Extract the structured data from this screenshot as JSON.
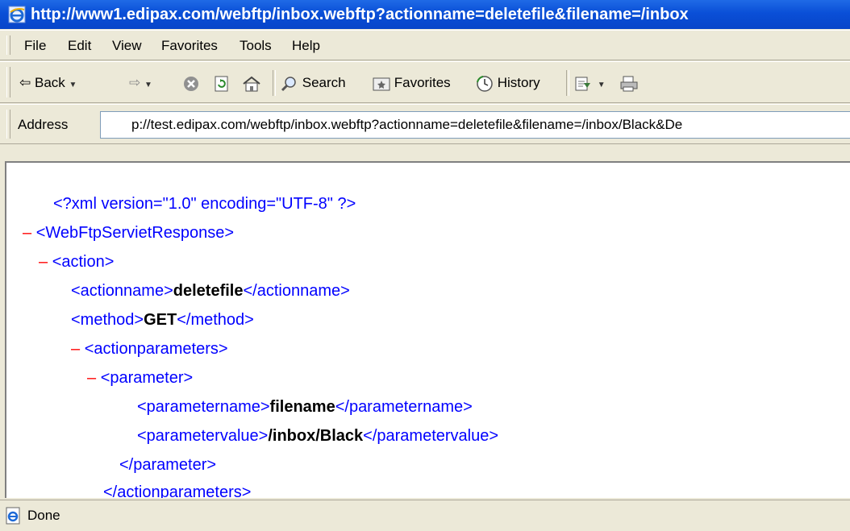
{
  "window": {
    "title": "http://www1.edipax.com/webftp/inbox.webftp?actionname=deletefile&filename=/inbox"
  },
  "menu": {
    "items": [
      "File",
      "Edit",
      "View",
      "Favorites",
      "Tools",
      "Help"
    ]
  },
  "toolbar": {
    "back_label": "Back",
    "search_label": "Search",
    "favorites_label": "Favorites",
    "history_label": "History"
  },
  "address": {
    "label": "Address",
    "value": "p://test.edipax.com/webftp/inbox.webftp?actionname=deletefile&filename=/inbox/Black&De"
  },
  "xml": {
    "decl": "<?xml version=\"1.0\" encoding=\"UTF-8\" ?>",
    "root_open": "<WebFtpServietResponse>",
    "action_open": "<action>",
    "actionname_open": "<actionname>",
    "actionname_value": "deletefile",
    "actionname_close": "</actionname>",
    "method_open": "<method>",
    "method_value": "GET",
    "method_close": "</method>",
    "actionparameters_open": "<actionparameters>",
    "parameter_open": "<parameter>",
    "parametername_open": "<parametername>",
    "parametername_value": "filename",
    "parametername_close": "</parametername>",
    "parametervalue_open": "<parametervalue>",
    "parametervalue_value": "/inbox/Black",
    "parametervalue_close": "</parametervalue>",
    "parameter_close": "</parameter>",
    "actionparameters_close": "</actionparameters>",
    "collapse_symbol": "–"
  },
  "status": {
    "text": "Done"
  },
  "colors": {
    "titlebar": "#0a4fd7",
    "chrome": "#ece9d8",
    "xml_tag": "#0000ff",
    "xml_minus": "#ff0000"
  }
}
